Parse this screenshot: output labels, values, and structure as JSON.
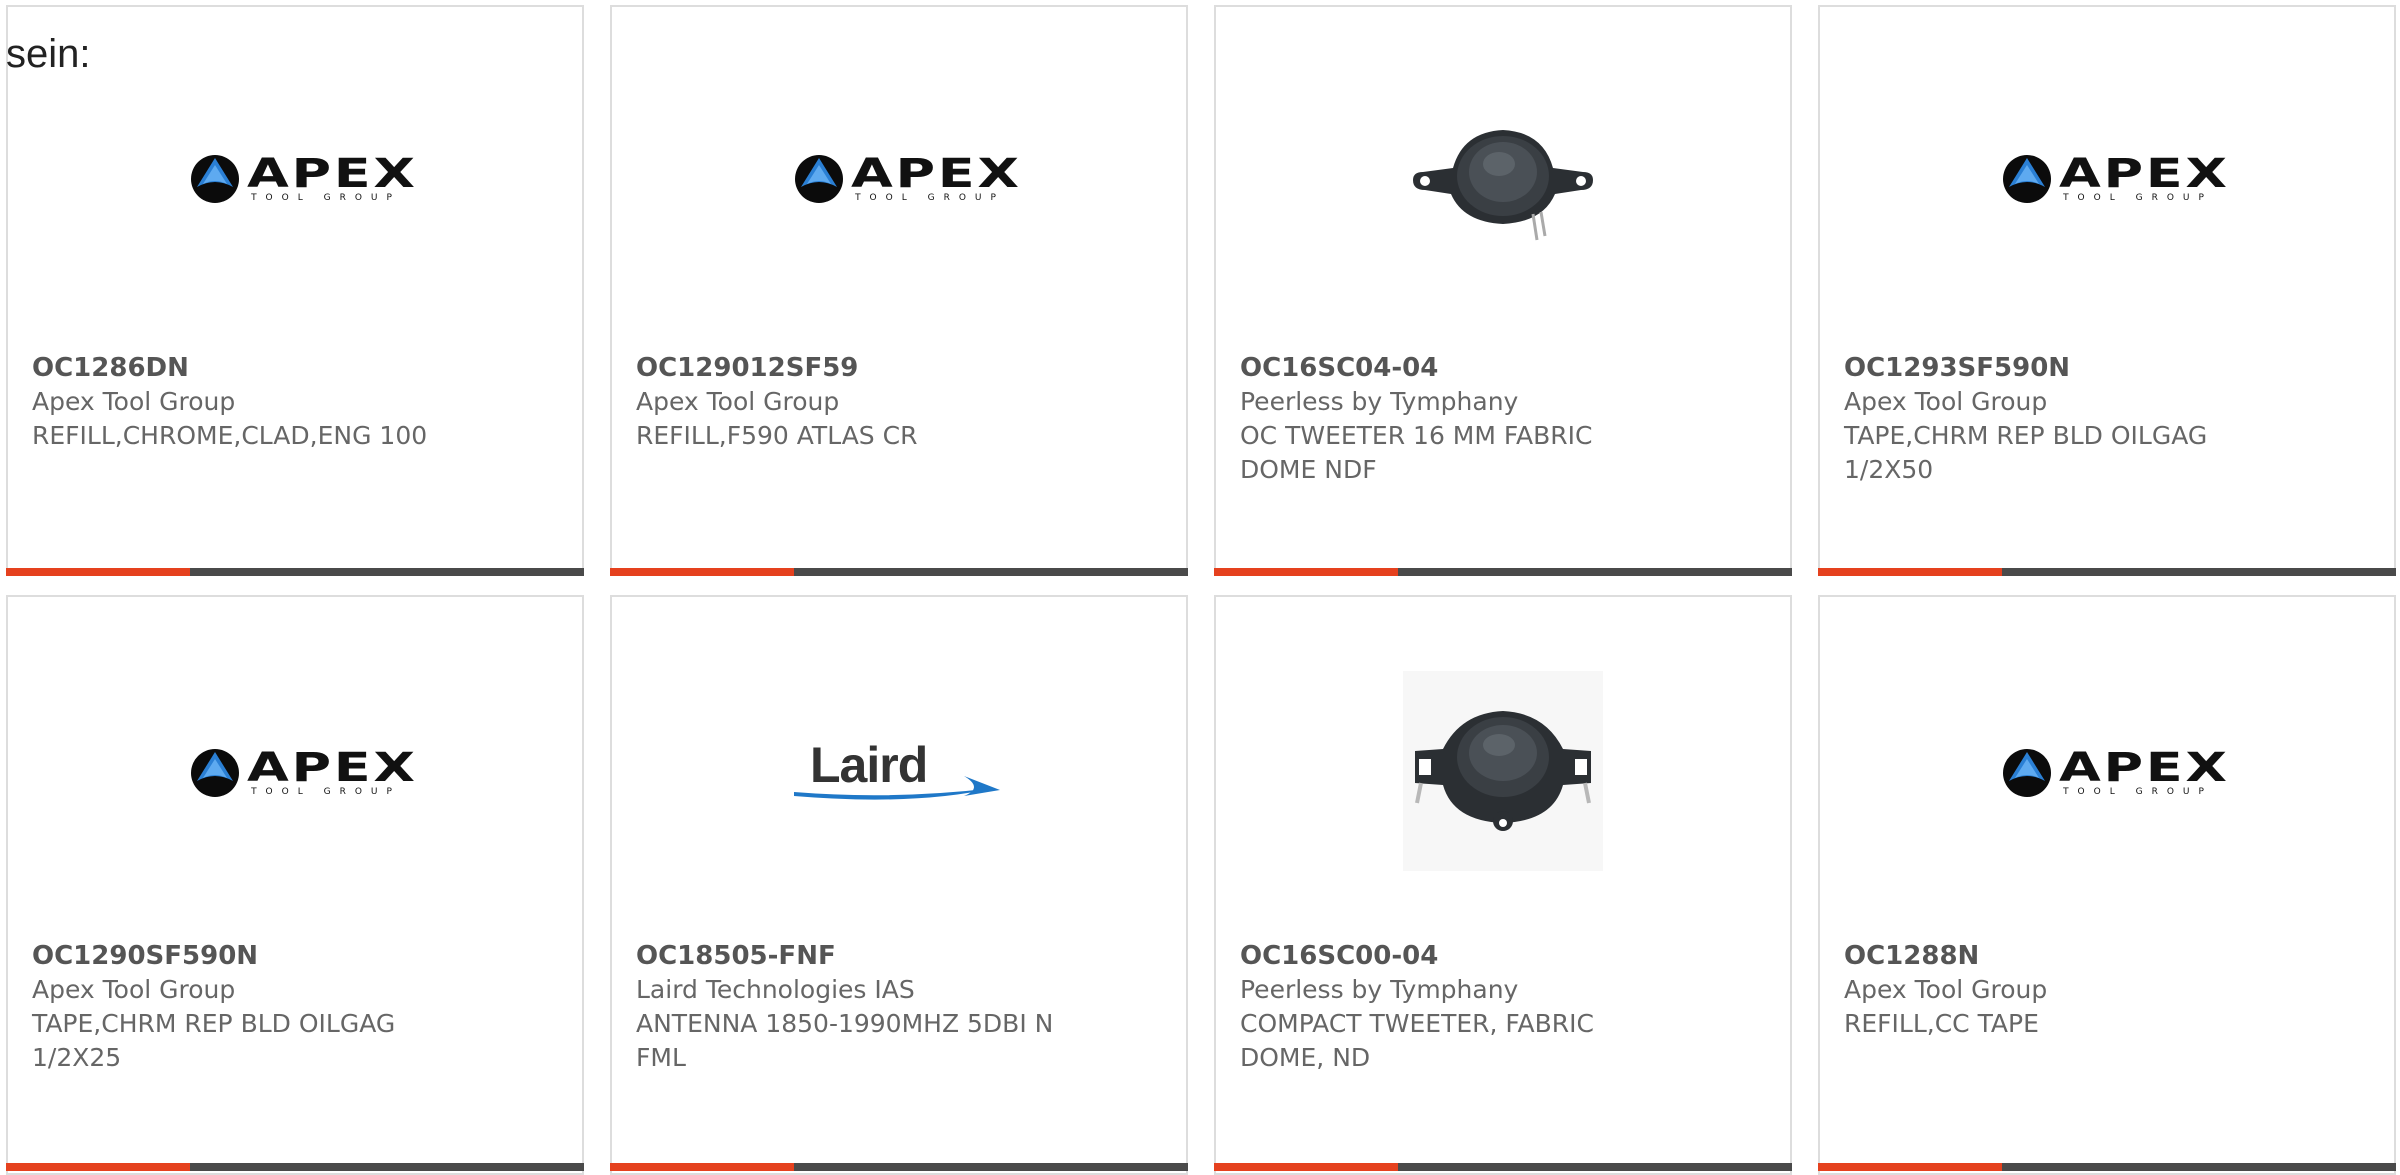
{
  "intro_text": "sein:",
  "colors": {
    "accent": "#e5411e",
    "bar": "#4a4a4a",
    "card_border": "#dddddd",
    "text": "#666666"
  },
  "brand_logos": {
    "apex": {
      "name": "APEX",
      "tagline": "TOOL GROUP"
    },
    "laird": {
      "name": "Laird"
    }
  },
  "products": [
    {
      "part_number": "OC1286DN",
      "manufacturer": "Apex Tool Group",
      "description": "REFILL,CHROME,CLAD,ENG 100",
      "image": "apex-tool-group-logo"
    },
    {
      "part_number": "OC129012SF59",
      "manufacturer": "Apex Tool Group",
      "description": "REFILL,F590 ATLAS CR",
      "image": "apex-tool-group-logo"
    },
    {
      "part_number": "OC16SC04-04",
      "manufacturer": "Peerless by Tymphany",
      "description": "OC TWEETER 16 MM FABRIC DOME NDF",
      "image": "tweeter-photo"
    },
    {
      "part_number": "OC1293SF590N",
      "manufacturer": "Apex Tool Group",
      "description": "TAPE,CHRM REP BLD OILGAG 1/2X50",
      "image": "apex-tool-group-logo"
    },
    {
      "part_number": "OC1290SF590N",
      "manufacturer": "Apex Tool Group",
      "description": "TAPE,CHRM REP BLD OILGAG 1/2X25",
      "image": "apex-tool-group-logo"
    },
    {
      "part_number": "OC18505-FNF",
      "manufacturer": "Laird Technologies IAS",
      "description": "ANTENNA 1850-1990MHZ 5DBI N FML",
      "image": "laird-logo"
    },
    {
      "part_number": "OC16SC00-04",
      "manufacturer": "Peerless by Tymphany",
      "description": "COMPACT TWEETER, FABRIC DOME, ND",
      "image": "tweeter-photo"
    },
    {
      "part_number": "OC1288N",
      "manufacturer": "Apex Tool Group",
      "description": "REFILL,CC TAPE",
      "image": "apex-tool-group-logo"
    }
  ]
}
